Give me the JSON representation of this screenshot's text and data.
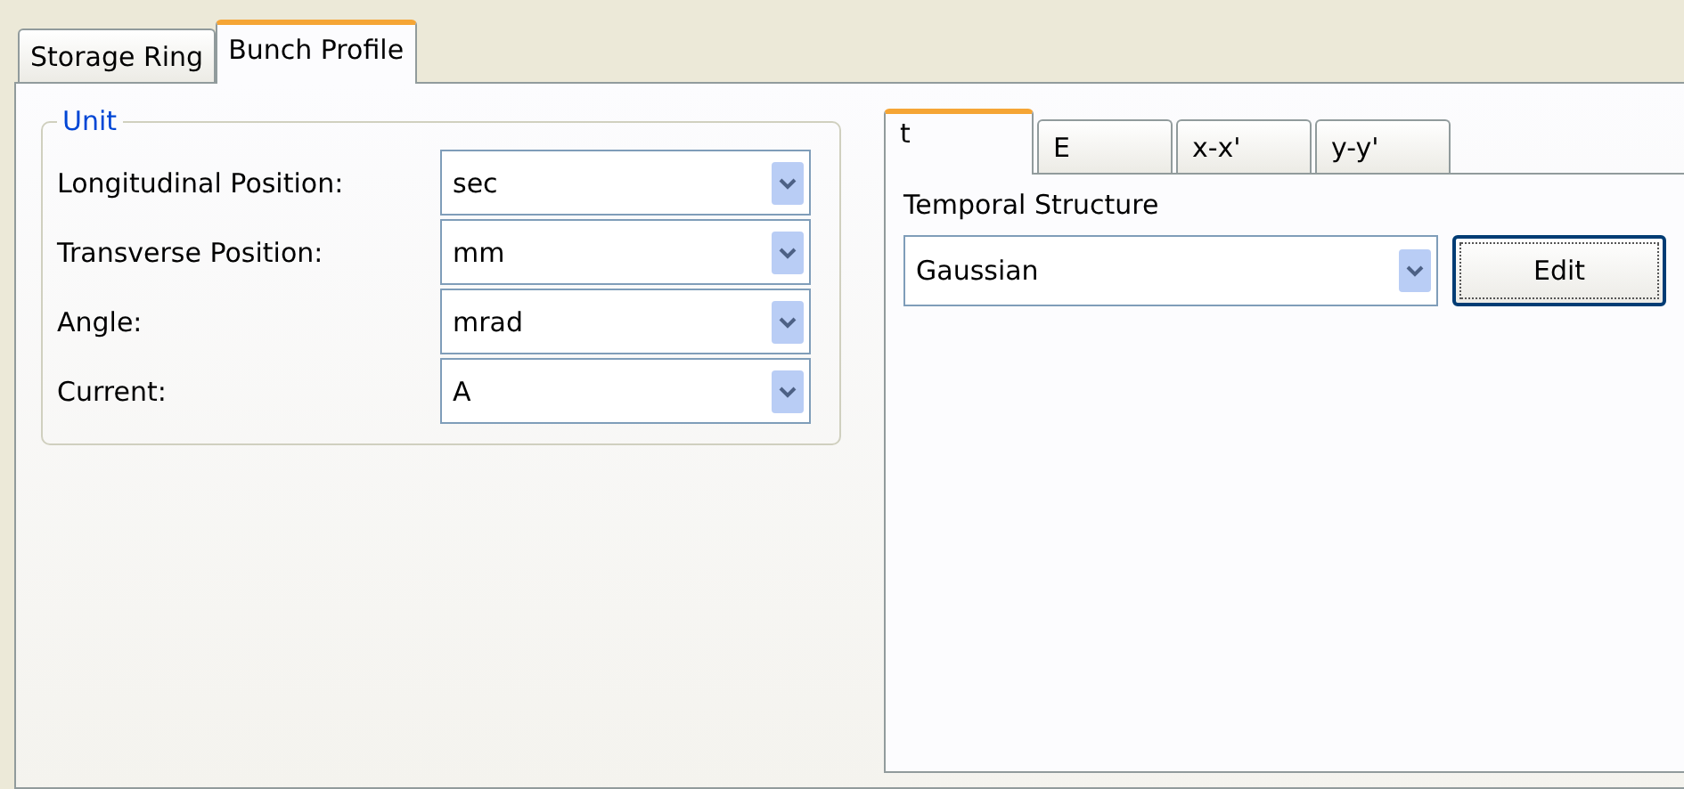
{
  "tabs": [
    {
      "label": "Storage Ring",
      "selected": false
    },
    {
      "label": "Bunch Profile",
      "selected": true
    }
  ],
  "unit_group": {
    "title": "Unit",
    "fields": [
      {
        "label": "Longitudinal Position:",
        "value": "sec"
      },
      {
        "label": "Transverse Position:",
        "value": "mm"
      },
      {
        "label": "Angle:",
        "value": "mrad"
      },
      {
        "label": "Current:",
        "value": "A"
      }
    ]
  },
  "profile_tabs": [
    {
      "label": "t",
      "selected": true
    },
    {
      "label": "E",
      "selected": false
    },
    {
      "label": "x-x'",
      "selected": false
    },
    {
      "label": "y-y'",
      "selected": false
    }
  ],
  "temporal": {
    "label": "Temporal Structure",
    "value": "Gaussian",
    "button": "Edit"
  }
}
